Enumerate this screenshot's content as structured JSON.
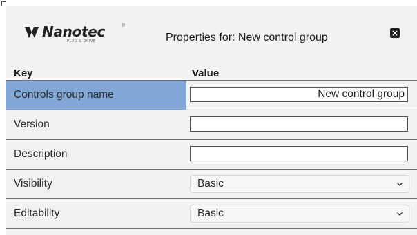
{
  "header": {
    "logo_text": "Nanotec",
    "logo_registered": "®",
    "logo_tagline": "PLUG & DRIVE",
    "title": "Properties for: New control group",
    "close_icon": "close-icon"
  },
  "table": {
    "col_key": "Key",
    "col_value": "Value",
    "rows": [
      {
        "key": "Controls group name",
        "type": "text",
        "value": "New control group",
        "selected": true
      },
      {
        "key": "Version",
        "type": "text",
        "value": ""
      },
      {
        "key": "Description",
        "type": "text",
        "value": ""
      },
      {
        "key": "Visibility",
        "type": "select",
        "value": "Basic"
      },
      {
        "key": "Editability",
        "type": "select",
        "value": "Basic"
      }
    ]
  },
  "colors": {
    "selected_row": "#83a8d8",
    "background": "#f2f2f2"
  }
}
